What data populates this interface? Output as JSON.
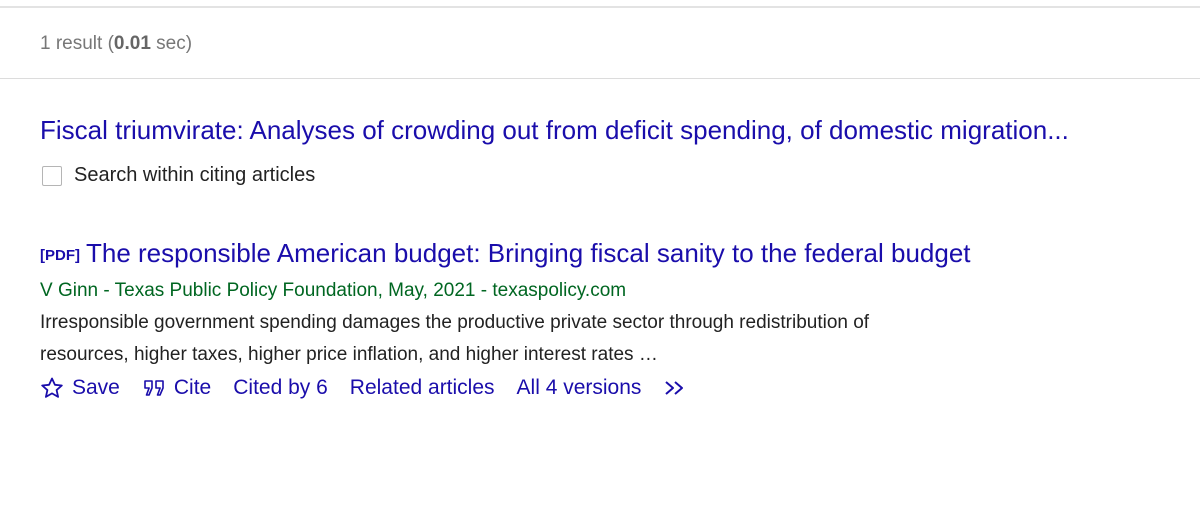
{
  "stats": {
    "prefix": "1 result (",
    "time": "0.01",
    "suffix": " sec)"
  },
  "cited_article": {
    "title": "Fiscal triumvirate: Analyses of crowding out from deficit spending, of domestic migration...",
    "search_within_label": "Search within citing articles",
    "search_within_checked": false
  },
  "result": {
    "format_tag": "[PDF]",
    "title": "The responsible American budget: Bringing fiscal sanity to the federal budget",
    "byline": "V Ginn - Texas Public Policy Foundation, May, 2021 - texaspolicy.com",
    "snippet": "Irresponsible government spending damages the productive private sector through redistribution of resources, higher taxes, higher price inflation, and higher interest rates …",
    "actions": {
      "save": "Save",
      "cite": "Cite",
      "cited_by": "Cited by 6",
      "related": "Related articles",
      "versions": "All 4 versions"
    }
  },
  "colors": {
    "link": "#1a0dab",
    "byline": "#006621",
    "text": "#222222",
    "muted": "#777777"
  },
  "icons": [
    "star-icon",
    "quote-icon",
    "more-chevrons-icon"
  ]
}
